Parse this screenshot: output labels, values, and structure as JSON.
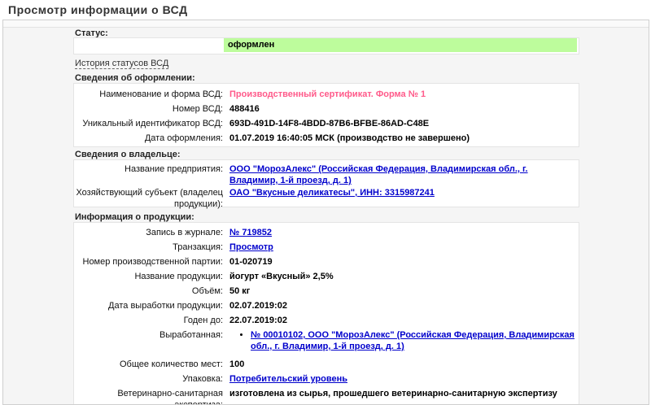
{
  "page": {
    "title": "Просмотр информации о ВСД"
  },
  "status": {
    "label": "Статус:",
    "value": "оформлен",
    "history_link": "История статусов ВСД"
  },
  "registration": {
    "header": "Сведения об оформлении:",
    "rows": [
      {
        "label": "Наименование и форма ВСД:",
        "value": "Производственный сертификат. Форма № 1"
      },
      {
        "label": "Номер ВСД:",
        "value": "488416"
      },
      {
        "label": "Уникальный идентификатор ВСД:",
        "value": "693D-491D-14F8-4BDD-87B6-BFBE-86AD-C48E"
      },
      {
        "label": "Дата оформления:",
        "value": "01.07.2019 16:40:05 МСК (производство не завершено)"
      }
    ]
  },
  "owner": {
    "header": "Сведения о владельце:",
    "rows": [
      {
        "label": "Название предприятия:",
        "value": "ООО \"МорозАлекс\" (Российская Федерация, Владимирская обл., г. Владимир, 1-й проезд, д. 1)"
      },
      {
        "label": "Хозяйствующий субъект (владелец продукции):",
        "value": "ОАО \"Вкусные деликатесы\", ИНН: 3315987241"
      }
    ]
  },
  "product": {
    "header": "Информация о продукции:",
    "rows": [
      {
        "label": "Запись в журнале:",
        "value": "№ 719852"
      },
      {
        "label": "Транзакция:",
        "value": "Просмотр"
      },
      {
        "label": "Номер производственной партии:",
        "value": "01-020719"
      },
      {
        "label": "Название продукции:",
        "value": "йогурт «Вкусный» 2,5%"
      },
      {
        "label": "Объём:",
        "value": "50 кг"
      },
      {
        "label": "Дата выработки продукции:",
        "value": "02.07.2019:02"
      },
      {
        "label": "Годен до:",
        "value": "22.07.2019:02"
      },
      {
        "label": "Выработанная:",
        "value": "№ 00010102, ООО \"МорозАлекс\" (Российская Федерация, Владимирская обл., г. Владимир, 1-й проезд, д. 1)"
      },
      {
        "label": "Общее количество мест:",
        "value": "100"
      },
      {
        "label": "Упаковка:",
        "value": "Потребительский уровень"
      },
      {
        "label": "Ветеринарно-санитарная экспертиза:",
        "value": "изготовлена из сырья, прошедшего ветеринарно-санитарную экспертизу"
      }
    ]
  },
  "colors": {
    "status_bg": "#bdfc9c",
    "form_name": "#ff5a8a",
    "link": "#0000cc"
  }
}
